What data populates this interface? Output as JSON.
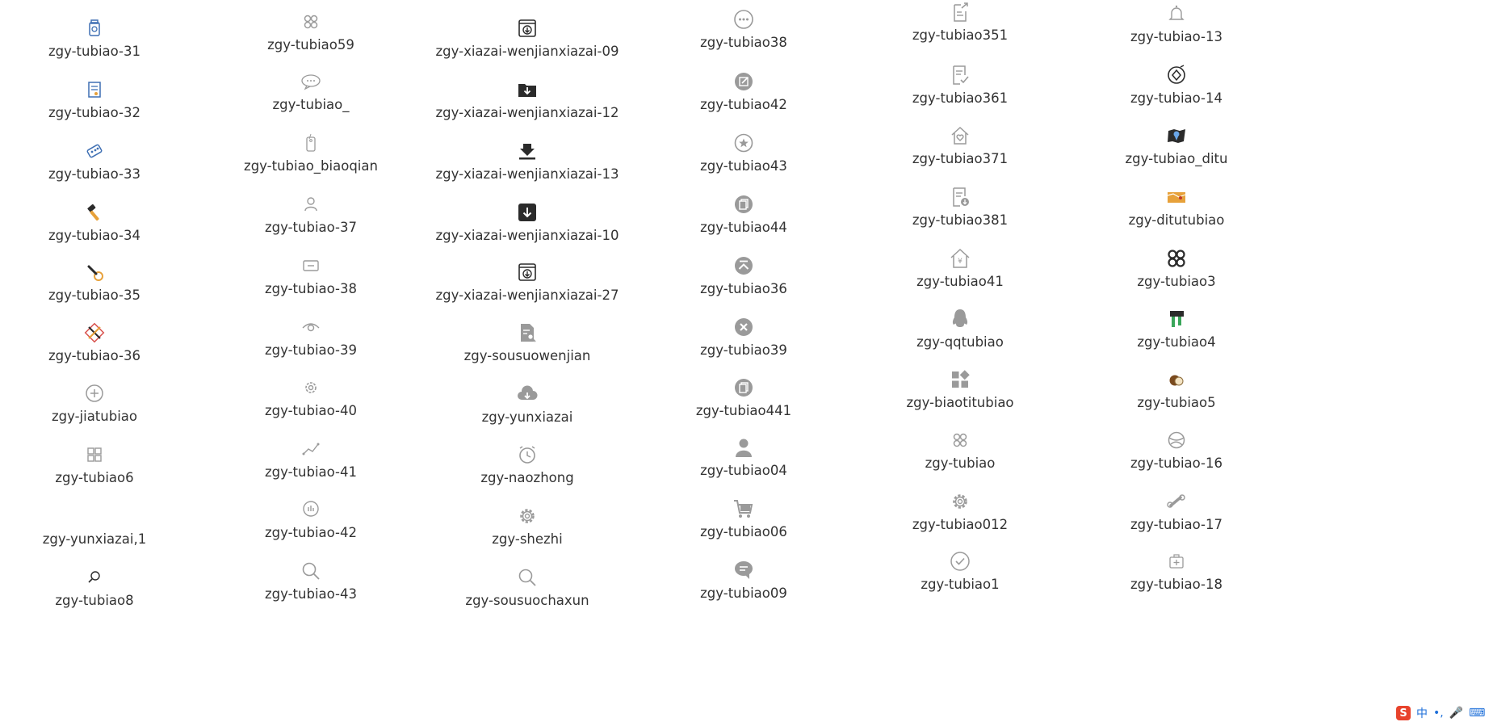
{
  "columns": [
    {
      "items": [
        {
          "label": "zgy-tubiao-31",
          "icon": "bottle-icon"
        },
        {
          "label": "zgy-tubiao-32",
          "icon": "document-icon"
        },
        {
          "label": "zgy-tubiao-33",
          "icon": "pill-pack-icon"
        },
        {
          "label": "zgy-tubiao-34",
          "icon": "hammer-icon"
        },
        {
          "label": "zgy-tubiao-35",
          "icon": "wrench-icon"
        },
        {
          "label": "zgy-tubiao-36",
          "icon": "tools-icon"
        },
        {
          "label": "zgy-jiatubiao",
          "icon": "plus-circle-icon"
        },
        {
          "label": "zgy-tubiao6",
          "icon": "grid-icon"
        },
        {
          "label": "zgy-yunxiazai,1",
          "icon": "blank-icon"
        },
        {
          "label": "zgy-tubiao8",
          "icon": "magnifier-small-icon"
        }
      ]
    },
    {
      "items": [
        {
          "label": "zgy-tubiao59",
          "icon": "command-icon"
        },
        {
          "label": "zgy-tubiao_",
          "icon": "chat-bubble-icon"
        },
        {
          "label": "zgy-tubiao_biaoqian",
          "icon": "tag-icon"
        },
        {
          "label": "zgy-tubiao-37",
          "icon": "person-icon"
        },
        {
          "label": "zgy-tubiao-38",
          "icon": "ticket-icon"
        },
        {
          "label": "zgy-tubiao-39",
          "icon": "eye-icon"
        },
        {
          "label": "zgy-tubiao-40",
          "icon": "gear-small-icon"
        },
        {
          "label": "zgy-tubiao-41",
          "icon": "line-chart-icon"
        },
        {
          "label": "zgy-tubiao-42",
          "icon": "bar-bubble-icon"
        },
        {
          "label": "zgy-tubiao-43",
          "icon": "search-icon"
        }
      ]
    },
    {
      "items": [
        {
          "label": "zgy-xiazai-wenjianxiazai-09",
          "icon": "download-box-icon"
        },
        {
          "label": "zgy-xiazai-wenjianxiazai-12",
          "icon": "folder-download-icon"
        },
        {
          "label": "zgy-xiazai-wenjianxiazai-13",
          "icon": "download-arrow-icon"
        },
        {
          "label": "zgy-xiazai-wenjianxiazai-10",
          "icon": "archive-download-icon"
        },
        {
          "label": "zgy-xiazai-wenjianxiazai-27",
          "icon": "download-box-icon"
        },
        {
          "label": "zgy-sousuowenjian",
          "icon": "file-search-icon"
        },
        {
          "label": "zgy-yunxiazai",
          "icon": "cloud-download-icon"
        },
        {
          "label": "zgy-naozhong",
          "icon": "alarm-clock-icon"
        },
        {
          "label": "zgy-shezhi",
          "icon": "settings-gear-icon"
        },
        {
          "label": "zgy-sousuochaxun",
          "icon": "search-icon"
        }
      ]
    },
    {
      "items": [
        {
          "label": "zgy-tubiao38",
          "icon": "more-circle-icon"
        },
        {
          "label": "zgy-tubiao42",
          "icon": "edit-circle-icon"
        },
        {
          "label": "zgy-tubiao43",
          "icon": "star-circle-icon"
        },
        {
          "label": "zgy-tubiao44",
          "icon": "copy-circle-icon"
        },
        {
          "label": "zgy-tubiao36",
          "icon": "top-arrow-circle-icon"
        },
        {
          "label": "zgy-tubiao39",
          "icon": "close-circle-icon"
        },
        {
          "label": "zgy-tubiao441",
          "icon": "copy-circle-icon"
        },
        {
          "label": "zgy-tubiao04",
          "icon": "user-icon"
        },
        {
          "label": "zgy-tubiao06",
          "icon": "cart-icon"
        },
        {
          "label": "zgy-tubiao09",
          "icon": "chat-circle-icon"
        }
      ]
    },
    {
      "items": [
        {
          "label": "zgy-tubiao351",
          "icon": "doc-share-icon"
        },
        {
          "label": "zgy-tubiao361",
          "icon": "doc-check-icon"
        },
        {
          "label": "zgy-tubiao371",
          "icon": "house-heart-icon"
        },
        {
          "label": "zgy-tubiao381",
          "icon": "doc-download-icon"
        },
        {
          "label": "zgy-tubiao41",
          "icon": "house-yen-icon"
        },
        {
          "label": "zgy-qqtubiao",
          "icon": "qq-penguin-icon"
        },
        {
          "label": "zgy-biaotitubiao",
          "icon": "widgets-icon"
        },
        {
          "label": "zgy-tubiao",
          "icon": "command-icon"
        },
        {
          "label": "zgy-tubiao012",
          "icon": "settings-gear-icon"
        },
        {
          "label": "zgy-tubiao1",
          "icon": "check-circle-icon"
        }
      ]
    },
    {
      "items": [
        {
          "label": "zgy-tubiao-13",
          "icon": "bell-icon"
        },
        {
          "label": "zgy-tubiao-14",
          "icon": "compass-icon"
        },
        {
          "label": "zgy-tubiao_ditu",
          "icon": "map-pin-icon"
        },
        {
          "label": "zgy-ditutubiao",
          "icon": "map-icon"
        },
        {
          "label": "zgy-tubiao3",
          "icon": "command-bold-icon"
        },
        {
          "label": "zgy-tubiao4",
          "icon": "flag-icon"
        },
        {
          "label": "zgy-tubiao5",
          "icon": "coconut-icon"
        },
        {
          "label": "zgy-tubiao-16",
          "icon": "ball-icon"
        },
        {
          "label": "zgy-tubiao-17",
          "icon": "bone-icon"
        },
        {
          "label": "zgy-tubiao-18",
          "icon": "medical-kit-icon"
        }
      ]
    }
  ],
  "tray": {
    "logo": "S",
    "ime": "中",
    "punct": "•,",
    "mic": "🎤",
    "kbd": "⌨"
  },
  "colors": {
    "icon_gray": "#9a9a9a",
    "icon_dark": "#2b2b2b",
    "icon_blue": "#3e6fb3",
    "icon_orange": "#e7a13a",
    "text": "#333333"
  }
}
